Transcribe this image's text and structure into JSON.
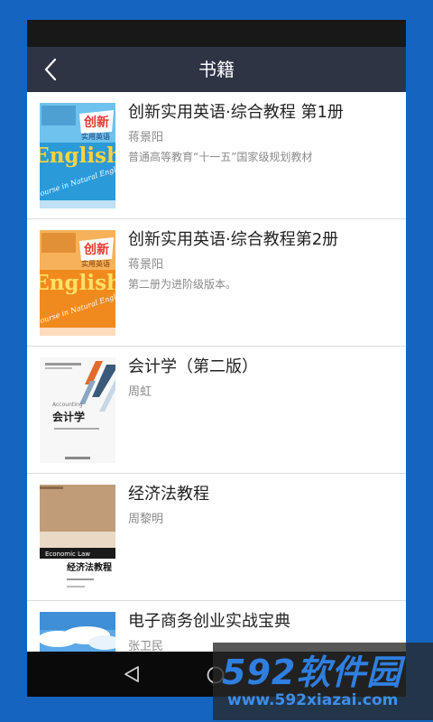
{
  "header": {
    "title": "书籍"
  },
  "books": [
    {
      "title": "创新实用英语·综合教程 第1册",
      "author": "蒋景阳",
      "desc": "普通高等教育“十一五”国家级规划教材",
      "cover": {
        "style": "english",
        "badge": "创新",
        "sub": "实用英语",
        "big": "English",
        "bg": "#2a9ad8",
        "script": "A Course in Natural English"
      }
    },
    {
      "title": "创新实用英语·综合教程第2册",
      "author": "蒋景阳",
      "desc": "第二册为进阶级版本。",
      "cover": {
        "style": "english",
        "badge": "创新",
        "sub": "实用英语",
        "big": "English",
        "bg": "#f08a1e",
        "script": "A Course in Natural English"
      }
    },
    {
      "title": "会计学（第二版）",
      "author": "周虹",
      "desc": "",
      "cover": {
        "style": "accounting",
        "en": "Accounting",
        "cn": "会计学"
      }
    },
    {
      "title": "经济法教程",
      "author": "周黎明",
      "desc": "",
      "cover": {
        "style": "law",
        "en": "Economic Law",
        "cn": "经济法教程"
      }
    },
    {
      "title": "电子商务创业实战宝典",
      "author": "张卫民",
      "desc": "",
      "cover": {
        "style": "sky"
      }
    }
  ],
  "watermark": {
    "brand": "592软件园",
    "url": "www.592xiazai.com"
  },
  "colors": {
    "appbar": "#2f3445",
    "page_bg": "#1565c0",
    "brand": "#2f7fe0"
  }
}
